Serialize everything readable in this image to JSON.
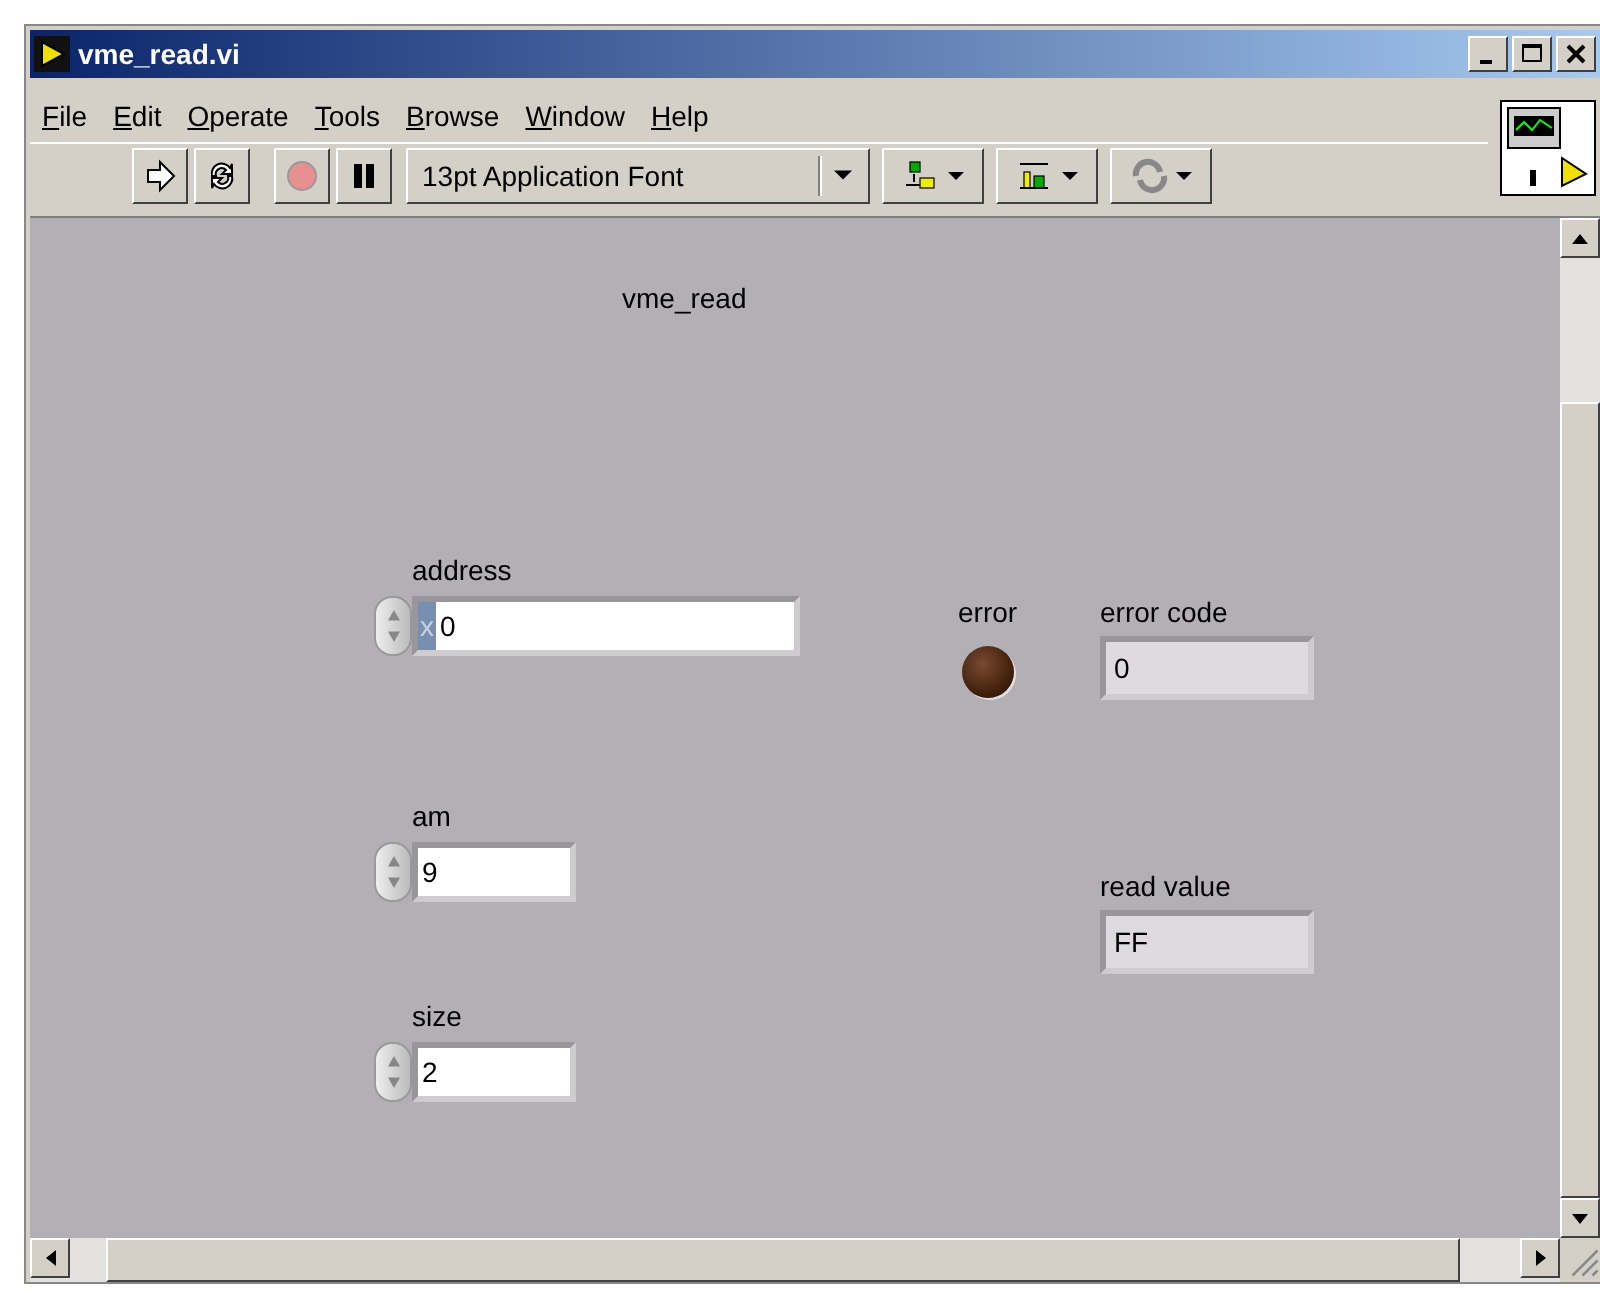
{
  "window": {
    "title": "vme_read.vi"
  },
  "menu": [
    {
      "label": "File"
    },
    {
      "label": "Edit"
    },
    {
      "label": "Operate"
    },
    {
      "label": "Tools"
    },
    {
      "label": "Browse"
    },
    {
      "label": "Window"
    },
    {
      "label": "Help"
    }
  ],
  "toolbar": {
    "font": "13pt Application Font"
  },
  "panel": {
    "label": "vme_read",
    "items": [
      {
        "kind": "control",
        "label": "address",
        "radix": "x",
        "value": "0",
        "wide": true
      },
      {
        "kind": "control",
        "label": "am",
        "value": "9",
        "wide": false
      },
      {
        "kind": "control",
        "label": "size",
        "value": "2",
        "wide": false
      },
      {
        "kind": "led",
        "label": "error",
        "on": false
      },
      {
        "kind": "indicator",
        "label": "error code",
        "value": "0"
      },
      {
        "kind": "indicator",
        "label": "read value",
        "value": "FF"
      }
    ]
  }
}
